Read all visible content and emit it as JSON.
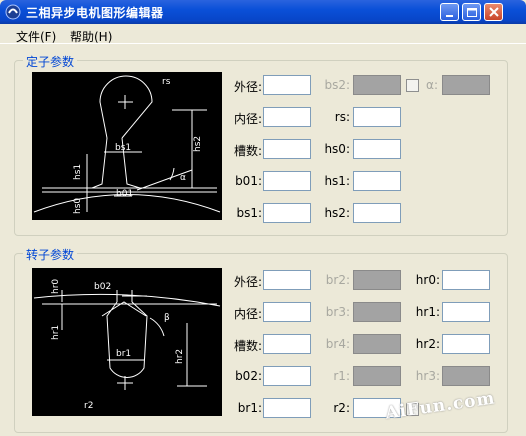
{
  "window": {
    "title": "三相异步电机图形编辑器"
  },
  "menu": {
    "items": [
      "文件(F)",
      "帮助(H)"
    ]
  },
  "stator": {
    "title": "定子参数",
    "diagram_labels": {
      "rs": "rs",
      "bs1": "bs1",
      "hs2": "hs2",
      "hs1": "hs1",
      "hs0": "hs0",
      "b01": "b01",
      "alpha": "α"
    },
    "fields_col1": [
      {
        "label": "外径:",
        "value": "",
        "enabled": true
      },
      {
        "label": "内径:",
        "value": "",
        "enabled": true
      },
      {
        "label": "槽数:",
        "value": "",
        "enabled": true
      },
      {
        "label": "b01:",
        "value": "",
        "enabled": true
      },
      {
        "label": "bs1:",
        "value": "",
        "enabled": true
      }
    ],
    "fields_col2": [
      {
        "label": "bs2:",
        "value": "",
        "enabled": false
      },
      {
        "label": "rs:",
        "value": "",
        "enabled": true
      },
      {
        "label": "hs0:",
        "value": "",
        "enabled": true
      },
      {
        "label": "hs1:",
        "value": "",
        "enabled": true
      },
      {
        "label": "hs2:",
        "value": "",
        "enabled": true
      }
    ],
    "alpha_field": {
      "label": "α:",
      "value": "",
      "enabled": false
    }
  },
  "rotor": {
    "title": "转子参数",
    "diagram_labels": {
      "hr0": "hr0",
      "b02": "b02",
      "hr1": "hr1",
      "beta": "β",
      "br1": "br1",
      "hr2": "hr2",
      "r2": "r2"
    },
    "fields_col1": [
      {
        "label": "外径:",
        "value": "",
        "enabled": true
      },
      {
        "label": "内径:",
        "value": "",
        "enabled": true
      },
      {
        "label": "槽数:",
        "value": "",
        "enabled": true
      },
      {
        "label": "b02:",
        "value": "",
        "enabled": true
      },
      {
        "label": "br1:",
        "value": "",
        "enabled": true
      }
    ],
    "fields_col2": [
      {
        "label": "br2:",
        "value": "",
        "enabled": false
      },
      {
        "label": "br3:",
        "value": "",
        "enabled": false
      },
      {
        "label": "br4:",
        "value": "",
        "enabled": false
      },
      {
        "label": "r1:",
        "value": "",
        "enabled": false
      },
      {
        "label": "r2:",
        "value": "",
        "enabled": true
      }
    ],
    "fields_col3": [
      {
        "label": "hr0:",
        "value": "",
        "enabled": true
      },
      {
        "label": "hr1:",
        "value": "",
        "enabled": true
      },
      {
        "label": "hr2:",
        "value": "",
        "enabled": true
      },
      {
        "label": "hr3:",
        "value": "",
        "enabled": false
      }
    ]
  },
  "watermark": "AiFun.com"
}
